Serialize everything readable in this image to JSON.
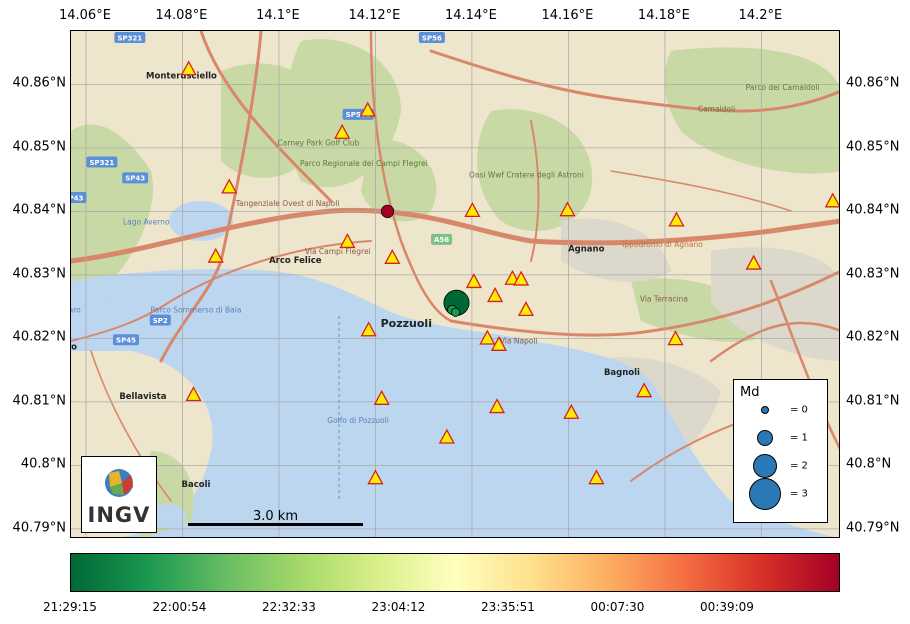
{
  "map": {
    "lon_ticks": [
      "14.06°E",
      "14.08°E",
      "14.1°E",
      "14.12°E",
      "14.14°E",
      "14.16°E",
      "14.18°E",
      "14.2°E"
    ],
    "lat_ticks": [
      "40.86°N",
      "40.85°N",
      "40.84°N",
      "40.83°N",
      "40.82°N",
      "40.81°N",
      "40.8°N",
      "40.79°N"
    ],
    "scale_label": "3.0 km",
    "logo_text": "INGV",
    "colors": {
      "sea": "#bcd6ef",
      "land": "#ede6cc",
      "green": "#c9d9a6",
      "road": "#d9876a",
      "grid": "#aaaaaa"
    },
    "places": [
      {
        "name": "Monterusciello",
        "lon": 14.0798,
        "lat": 40.8614,
        "kind": "town"
      },
      {
        "name": "Parco Regionale dei Campi Flegrei",
        "lon": 14.1176,
        "lat": 40.8475,
        "kind": "park"
      },
      {
        "name": "Carney Park Golf Club",
        "lon": 14.1082,
        "lat": 40.8508,
        "kind": "park"
      },
      {
        "name": "Oasi Wwf Cratere degli Astroni",
        "lon": 14.1513,
        "lat": 40.8457,
        "kind": "park"
      },
      {
        "name": "Parco dei Camaldoli",
        "lon": 14.2044,
        "lat": 40.8595,
        "kind": "park"
      },
      {
        "name": "Camaldoli",
        "lon": 14.1907,
        "lat": 40.8561,
        "kind": "park"
      },
      {
        "name": "Lago Averno",
        "lon": 14.0725,
        "lat": 40.8383,
        "kind": "water"
      },
      {
        "name": "Arco Felice",
        "lon": 14.1034,
        "lat": 40.8323,
        "kind": "town"
      },
      {
        "name": "Agnano",
        "lon": 14.1637,
        "lat": 40.8341,
        "kind": "town"
      },
      {
        "name": "Ippodromo di Agnano",
        "lon": 14.1795,
        "lat": 40.8348,
        "kind": "poi"
      },
      {
        "name": "Parco Sommerso di Baia",
        "lon": 14.0828,
        "lat": 40.8245,
        "kind": "water"
      },
      {
        "name": "Lago del Fusaro",
        "lon": 14.0528,
        "lat": 40.8245,
        "kind": "water"
      },
      {
        "name": "Fusaro",
        "lon": 14.0548,
        "lat": 40.8187,
        "kind": "town"
      },
      {
        "name": "Pozzuoli",
        "lon": 14.1264,
        "lat": 40.8224,
        "kind": "city"
      },
      {
        "name": "Bagnoli",
        "lon": 14.1711,
        "lat": 40.8147,
        "kind": "town"
      },
      {
        "name": "Bellavista",
        "lon": 14.0718,
        "lat": 40.8109,
        "kind": "town"
      },
      {
        "name": "Golfo di Pozzuoli",
        "lon": 14.1164,
        "lat": 40.8071,
        "kind": "water"
      },
      {
        "name": "Bacoli",
        "lon": 14.0828,
        "lat": 40.797,
        "kind": "town"
      },
      {
        "name": "Via Campi Flegrei",
        "lon": 14.1122,
        "lat": 40.8337,
        "kind": "road"
      },
      {
        "name": "Via Napoli",
        "lon": 14.1497,
        "lat": 40.8196,
        "kind": "road"
      },
      {
        "name": "Via Terracina",
        "lon": 14.1798,
        "lat": 40.8262,
        "kind": "road"
      },
      {
        "name": "Tangenziale Ovest di Napoli",
        "lon": 14.1018,
        "lat": 40.8412,
        "kind": "road"
      },
      {
        "name": "SP321",
        "lon": 14.0691,
        "lat": 40.8673,
        "kind": "shield"
      },
      {
        "name": "SP321",
        "lon": 14.0633,
        "lat": 40.8477,
        "kind": "shield"
      },
      {
        "name": "SP43",
        "lon": 14.0702,
        "lat": 40.8452,
        "kind": "shield"
      },
      {
        "name": "SP43",
        "lon": 14.0574,
        "lat": 40.8421,
        "kind": "shield"
      },
      {
        "name": "SP501",
        "lon": 14.1164,
        "lat": 40.8552,
        "kind": "shield"
      },
      {
        "name": "SP56",
        "lon": 14.1317,
        "lat": 40.8673,
        "kind": "shield"
      },
      {
        "name": "A56",
        "lon": 14.1337,
        "lat": 40.8355,
        "kind": "shield"
      },
      {
        "name": "SP2",
        "lon": 14.0754,
        "lat": 40.8228,
        "kind": "shield"
      },
      {
        "name": "SP45",
        "lon": 14.0683,
        "lat": 40.8197,
        "kind": "shield"
      }
    ]
  },
  "stations": [
    {
      "lon": 14.0813,
      "lat": 40.8623
    },
    {
      "lon": 14.0538,
      "lat": 40.8478
    },
    {
      "lon": 14.1184,
      "lat": 40.8558
    },
    {
      "lon": 14.1131,
      "lat": 40.8523
    },
    {
      "lon": 14.0897,
      "lat": 40.8437
    },
    {
      "lon": 14.1401,
      "lat": 40.84
    },
    {
      "lon": 14.1598,
      "lat": 40.8401
    },
    {
      "lon": 14.1824,
      "lat": 40.8385
    },
    {
      "lon": 14.2148,
      "lat": 40.8415
    },
    {
      "lon": 14.1142,
      "lat": 40.8351
    },
    {
      "lon": 14.0869,
      "lat": 40.8328
    },
    {
      "lon": 14.1235,
      "lat": 40.8326
    },
    {
      "lon": 14.1984,
      "lat": 40.8317
    },
    {
      "lon": 14.1404,
      "lat": 40.8288
    },
    {
      "lon": 14.1484,
      "lat": 40.8293
    },
    {
      "lon": 14.1502,
      "lat": 40.8292
    },
    {
      "lon": 14.1448,
      "lat": 40.8266
    },
    {
      "lon": 14.1512,
      "lat": 40.8244
    },
    {
      "lon": 14.1186,
      "lat": 40.8212
    },
    {
      "lon": 14.1432,
      "lat": 40.8199
    },
    {
      "lon": 14.1456,
      "lat": 40.8189
    },
    {
      "lon": 14.1822,
      "lat": 40.8198
    },
    {
      "lon": 14.0823,
      "lat": 40.811
    },
    {
      "lon": 14.1213,
      "lat": 40.8104
    },
    {
      "lon": 14.1757,
      "lat": 40.8116
    },
    {
      "lon": 14.1452,
      "lat": 40.8091
    },
    {
      "lon": 14.1606,
      "lat": 40.8082
    },
    {
      "lon": 14.1348,
      "lat": 40.8043
    },
    {
      "lon": 14.12,
      "lat": 40.7979
    },
    {
      "lon": 14.1658,
      "lat": 40.7979
    }
  ],
  "events": [
    {
      "lon": 14.1368,
      "lat": 40.8256,
      "md": 2.4,
      "color": "#006837"
    },
    {
      "lon": 14.1359,
      "lat": 40.8245,
      "md": 0.4,
      "color": "#1a9850"
    },
    {
      "lon": 14.1366,
      "lat": 40.8241,
      "md": 0.3,
      "color": "#1a9850"
    },
    {
      "lon": 14.1225,
      "lat": 40.84,
      "md": 0.8,
      "color": "#a50026"
    }
  ],
  "legend": {
    "title": "Md",
    "entries": [
      {
        "md": 0,
        "label": "= 0"
      },
      {
        "md": 1,
        "label": "= 1"
      },
      {
        "md": 2,
        "label": "= 2"
      },
      {
        "md": 3,
        "label": "= 3"
      }
    ]
  },
  "colorbar": {
    "labels": [
      "21:29:15",
      "22:00:54",
      "22:32:33",
      "23:04:12",
      "23:35:51",
      "00:07:30",
      "00:39:09"
    ]
  }
}
